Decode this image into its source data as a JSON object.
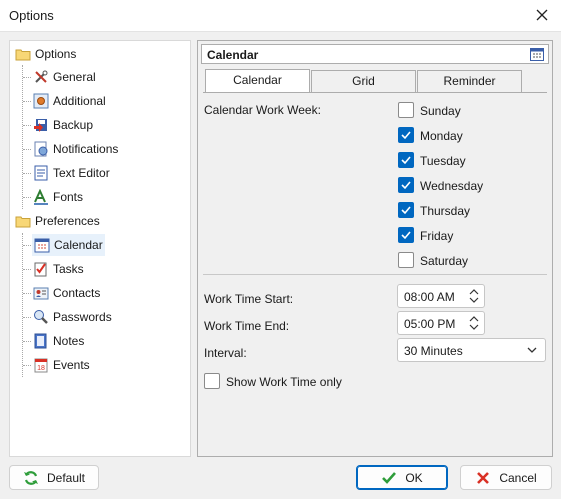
{
  "window": {
    "title": "Options"
  },
  "tree": {
    "items": [
      {
        "label": "Options",
        "icon": "folder-icon"
      },
      {
        "label": "General",
        "icon": "tools-icon"
      },
      {
        "label": "Additional",
        "icon": "gear-box-icon"
      },
      {
        "label": "Backup",
        "icon": "backup-icon"
      },
      {
        "label": "Notifications",
        "icon": "notification-icon"
      },
      {
        "label": "Text Editor",
        "icon": "text-editor-icon"
      },
      {
        "label": "Fonts",
        "icon": "fonts-icon"
      },
      {
        "label": "Preferences",
        "icon": "folder-icon"
      },
      {
        "label": "Calendar",
        "icon": "calendar-icon"
      },
      {
        "label": "Tasks",
        "icon": "tasks-icon"
      },
      {
        "label": "Contacts",
        "icon": "contacts-icon"
      },
      {
        "label": "Passwords",
        "icon": "passwords-icon"
      },
      {
        "label": "Notes",
        "icon": "notes-icon"
      },
      {
        "label": "Events",
        "icon": "events-icon"
      }
    ],
    "selected": "Calendar"
  },
  "panel": {
    "title": "Calendar",
    "tabs": [
      "Calendar",
      "Grid",
      "Reminder"
    ],
    "active_tab": "Calendar",
    "work_week_label": "Calendar Work Week:",
    "days": [
      {
        "label": "Sunday",
        "checked": false
      },
      {
        "label": "Monday",
        "checked": true
      },
      {
        "label": "Tuesday",
        "checked": true
      },
      {
        "label": "Wednesday",
        "checked": true
      },
      {
        "label": "Thursday",
        "checked": true
      },
      {
        "label": "Friday",
        "checked": true
      },
      {
        "label": "Saturday",
        "checked": false
      }
    ],
    "work_start": {
      "label": "Work Time Start:",
      "value": "08:00 AM"
    },
    "work_end": {
      "label": "Work Time End:",
      "value": "05:00 PM"
    },
    "interval": {
      "label": "Interval:",
      "value": "30 Minutes"
    },
    "show_work_time": {
      "label": "Show Work Time only",
      "checked": false
    }
  },
  "buttons": {
    "default": "Default",
    "ok": "OK",
    "cancel": "Cancel"
  },
  "colors": {
    "accent": "#0067c0",
    "window_bg": "#f0f0f0",
    "selection": "#e7f1fb"
  }
}
